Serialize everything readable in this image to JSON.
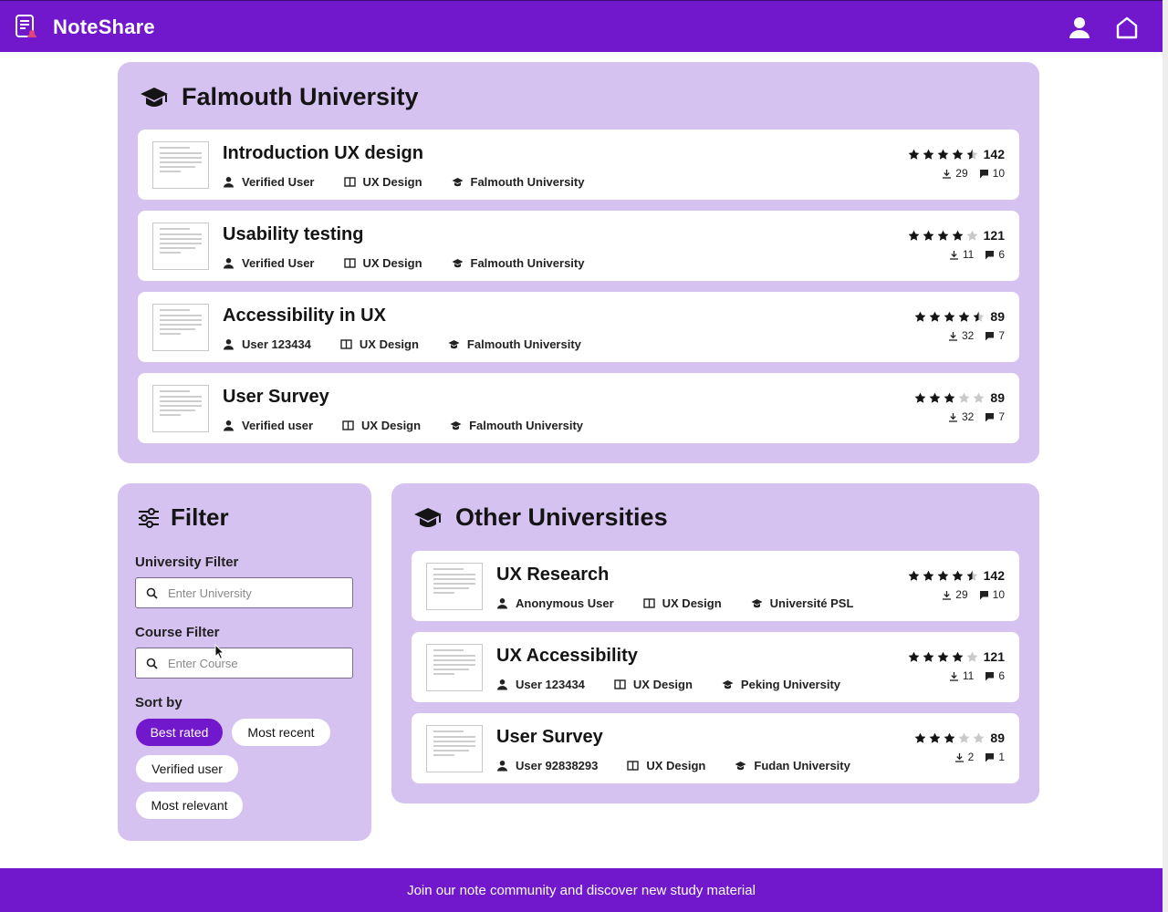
{
  "app": {
    "name": "NoteShare",
    "accent": "#7118cc",
    "panel_bg": "#d6c2f0"
  },
  "header": {
    "icons": [
      "notes-logo-icon",
      "user-icon",
      "home-icon"
    ]
  },
  "falmouth": {
    "title": "Falmouth University",
    "notes": [
      {
        "title": "Introduction UX design",
        "author": "Verified User",
        "course": "UX Design",
        "university": "Falmouth University",
        "rating": 4.5,
        "ratings": "142",
        "downloads": "29",
        "comments": "10"
      },
      {
        "title": "Usability testing",
        "author": "Verified User",
        "course": "UX Design",
        "university": "Falmouth University",
        "rating": 4,
        "ratings": "121",
        "downloads": "11",
        "comments": "6"
      },
      {
        "title": "Accessibility in UX",
        "author": "User 123434",
        "course": "UX Design",
        "university": "Falmouth University",
        "rating": 4.5,
        "ratings": "89",
        "downloads": "32",
        "comments": "7"
      },
      {
        "title": "User Survey",
        "author": "Verified user",
        "course": "UX Design",
        "university": "Falmouth University",
        "rating": 3,
        "ratings": "89",
        "downloads": "32",
        "comments": "7"
      }
    ]
  },
  "filter": {
    "title": "Filter",
    "university_label": "University Filter",
    "university_placeholder": "Enter University",
    "course_label": "Course Filter",
    "course_placeholder": "Enter Course",
    "sort_label": "Sort by",
    "sort_options": [
      "Best rated",
      "Most recent",
      "Verified user",
      "Most relevant"
    ],
    "sort_selected": "Best rated"
  },
  "other": {
    "title": "Other Universities",
    "notes": [
      {
        "title": "UX Research",
        "author": "Anonymous User",
        "course": "UX Design",
        "university": "Université PSL",
        "rating": 4.5,
        "ratings": "142",
        "downloads": "29",
        "comments": "10"
      },
      {
        "title": "UX Accessibility",
        "author": "User 123434",
        "course": "UX Design",
        "university": "Peking University",
        "rating": 4,
        "ratings": "121",
        "downloads": "11",
        "comments": "6"
      },
      {
        "title": "User Survey",
        "author": "User 92838293",
        "course": "UX Design",
        "university": "Fudan University",
        "rating": 3,
        "ratings": "89",
        "downloads": "2",
        "comments": "1"
      }
    ]
  },
  "footer": {
    "text": "Join our note community and discover new study material"
  }
}
